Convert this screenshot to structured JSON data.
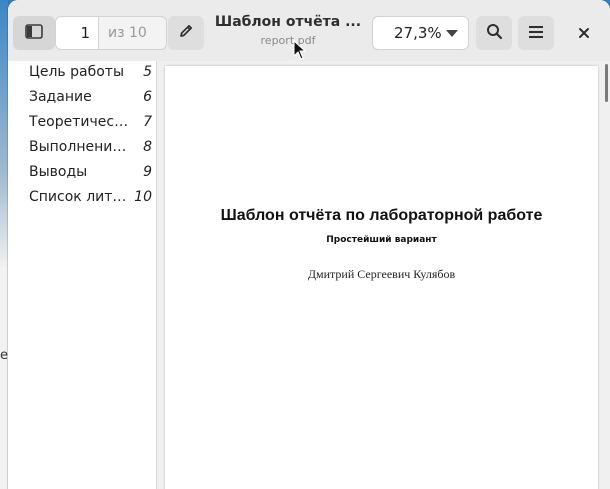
{
  "header": {
    "page_current": "1",
    "page_total": "из 10",
    "title": "Шаблон отчёта ...",
    "filename": "report.pdf",
    "zoom": "27,3%"
  },
  "sidebar": {
    "items": [
      {
        "label": "Цель работы",
        "page": "5"
      },
      {
        "label": "Задание",
        "page": "6"
      },
      {
        "label": "Теоретичес…",
        "page": "7"
      },
      {
        "label": "Выполнение…",
        "page": "8"
      },
      {
        "label": "Выводы",
        "page": "9"
      },
      {
        "label": "Список лите…",
        "page": "10"
      }
    ]
  },
  "document": {
    "title": "Шаблон отчёта по лабораторной работе",
    "subtitle": "Простейший вариант",
    "author": "Дмитрий Сергеевич Кулябов"
  },
  "background": {
    "edge_char": "е"
  },
  "icons": {
    "sidebar_toggle": "sidebar-icon",
    "edit": "pencil-icon",
    "search": "search-icon",
    "menu": "hamburger-menu-icon",
    "close": "close-icon",
    "zoom_dropdown": "dropdown-arrow-icon",
    "cursor": "mouse-pointer"
  }
}
